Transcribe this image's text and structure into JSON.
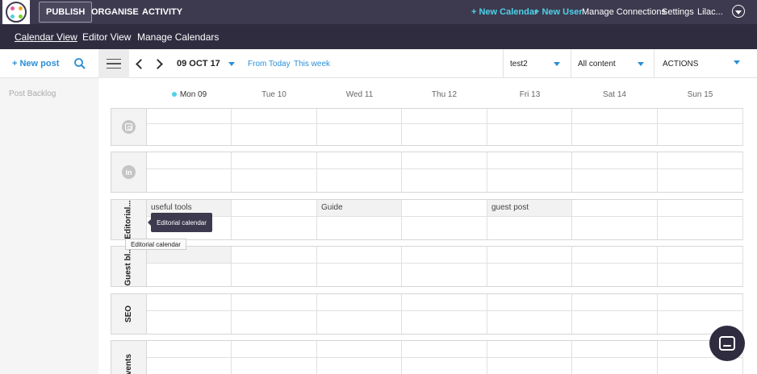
{
  "topbar": {
    "nav": [
      "PUBLISH",
      "ORGANISE",
      "ACTIVITY"
    ],
    "new_calendar": "+ New Calendar",
    "new_user": "+ New User",
    "manage_connections": "Manage Connections",
    "settings": "Settings",
    "user": "Lilac..."
  },
  "subbar": {
    "calendar_view": "Calendar View",
    "editor_view": "Editor View",
    "manage_calendars": "Manage Calendars"
  },
  "toolbar": {
    "new_post": "+ New post",
    "date": "09 OCT 17",
    "from_today": "From Today",
    "this_week": "This week",
    "calendar_select": "test2",
    "content_select": "All content",
    "actions": "ACTIONS"
  },
  "sidebar": {
    "backlog": "Post Backlog"
  },
  "days": [
    "Mon 09",
    "Tue 10",
    "Wed 11",
    "Thu 12",
    "Fri 13",
    "Sat 14",
    "Sun 15"
  ],
  "rows": {
    "instagram_icon": "instagram-icon",
    "linkedin_icon": "linkedin-icon",
    "linkedin_glyph": "in",
    "editorial": "Editorial...",
    "guest": "Guest bl...",
    "seo": "SEO",
    "events": "Events"
  },
  "posts": {
    "useful_tools": "useful tools",
    "guide": "Guide",
    "guest_post": "guest post"
  },
  "tooltips": {
    "dark": "Editorial calendar",
    "light": "Editorial calendar"
  },
  "colors": {
    "topbar": "#3d3a4f",
    "subbar": "#2f2c40",
    "accent": "#4fd1ea",
    "link": "#2a8fd6"
  }
}
